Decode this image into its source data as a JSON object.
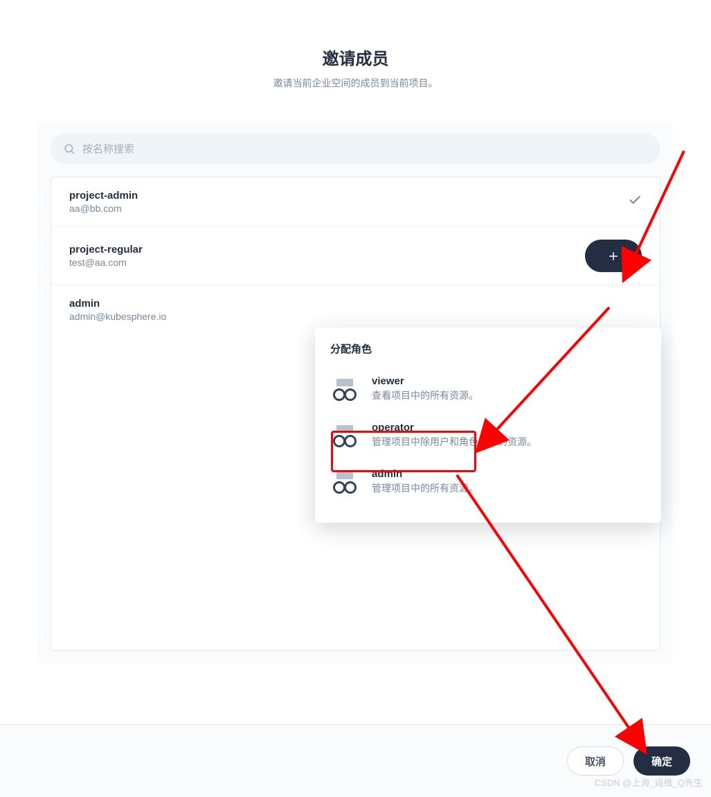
{
  "header": {
    "title": "邀请成员",
    "subtitle": "邀请当前企业空间的成员到当前项目。"
  },
  "search": {
    "placeholder": "按名称搜索"
  },
  "members": [
    {
      "name": "project-admin",
      "email": "aa@bb.com",
      "status": "added"
    },
    {
      "name": "project-regular",
      "email": "test@aa.com",
      "status": "addable"
    },
    {
      "name": "admin",
      "email": "admin@kubesphere.io",
      "status": "none"
    }
  ],
  "popover": {
    "title": "分配角色",
    "roles": [
      {
        "name": "viewer",
        "desc": "查看项目中的所有资源。"
      },
      {
        "name": "operator",
        "desc": "管理项目中除用户和角色之外的资源。"
      },
      {
        "name": "admin",
        "desc": "管理项目中的所有资源。"
      }
    ]
  },
  "footer": {
    "cancel": "取消",
    "ok": "确定"
  },
  "watermark": "CSDN @上海_运维_Q先生"
}
